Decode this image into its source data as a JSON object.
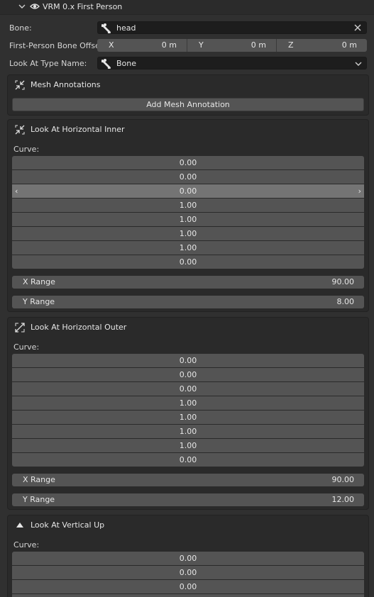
{
  "panel": {
    "title": "VRM 0.x First Person"
  },
  "bone": {
    "label": "Bone:",
    "value": "head"
  },
  "offset": {
    "label": "First-Person Bone Offset:",
    "x_axis": "X",
    "x_value": "0 m",
    "y_axis": "Y",
    "y_value": "0 m",
    "z_axis": "Z",
    "z_value": "0 m"
  },
  "look_at_type": {
    "label": "Look At Type Name:",
    "value": "Bone"
  },
  "mesh_annotations": {
    "title": "Mesh Annotations",
    "add_button": "Add Mesh Annotation"
  },
  "sections": [
    {
      "title": "Look At Horizontal Inner",
      "curve_label": "Curve:",
      "curve": [
        "0.00",
        "0.00",
        "0.00",
        "1.00",
        "1.00",
        "1.00",
        "1.00",
        "0.00"
      ],
      "x_range_label": "X Range",
      "x_range": "90.00",
      "y_range_label": "Y Range",
      "y_range": "8.00"
    },
    {
      "title": "Look At Horizontal Outer",
      "curve_label": "Curve:",
      "curve": [
        "0.00",
        "0.00",
        "0.00",
        "1.00",
        "1.00",
        "1.00",
        "1.00",
        "0.00"
      ],
      "x_range_label": "X Range",
      "x_range": "90.00",
      "y_range_label": "Y Range",
      "y_range": "12.00"
    },
    {
      "title": "Look At Vertical Up",
      "curve_label": "Curve:",
      "curve": [
        "0.00",
        "0.00",
        "0.00"
      ]
    }
  ],
  "icons": {
    "panel_collapse": "chevron-down-icon",
    "panel_visibility": "eye-icon",
    "bone_field": "bone-icon",
    "clear": "close-icon",
    "dropdown": "chevron-down-icon",
    "mesh_annotations": "shrink-arrows-icon",
    "horizontal_inner": "shrink-arrows-icon",
    "horizontal_outer": "expand-arrows-icon",
    "vertical_up": "triangle-up-icon"
  },
  "colors": {
    "background": "#303030",
    "field_dark": "#1d1d1d",
    "button": "#545454",
    "selected_row": "#747474",
    "text": "#e6e6e6"
  }
}
